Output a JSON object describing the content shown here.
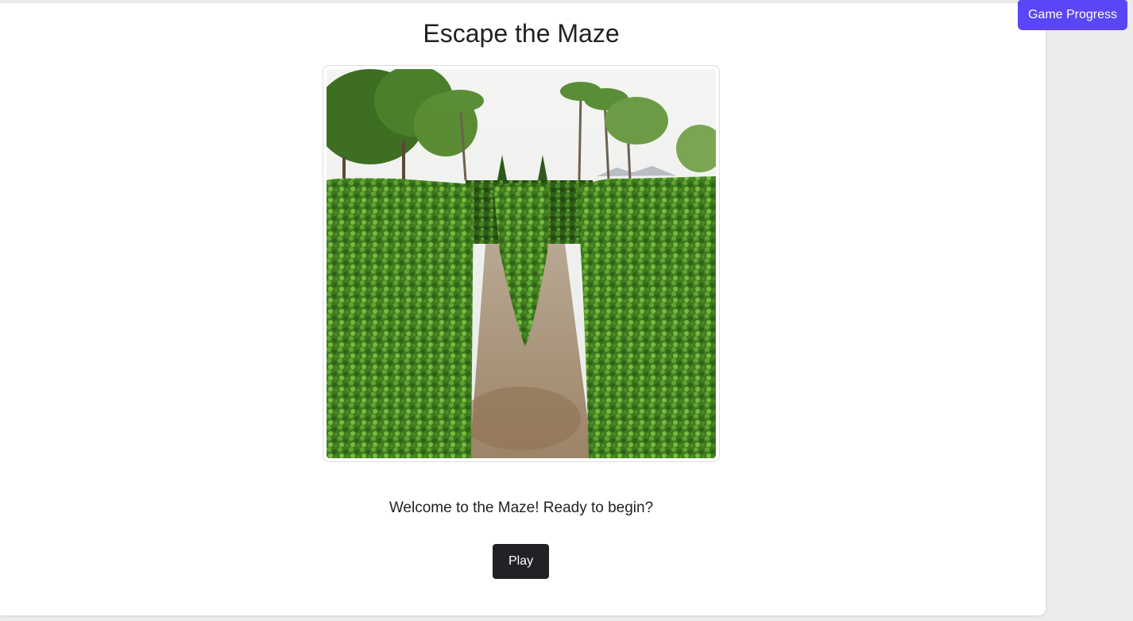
{
  "game": {
    "title": "Escape the Maze",
    "image_subject": "hedge maze path",
    "welcome_text": "Welcome to the Maze! Ready to begin?",
    "play_label": "Play"
  },
  "header": {
    "progress_label": "Game Progress"
  },
  "colors": {
    "accent": "#5b46f5",
    "play_button": "#212226",
    "background": "#ececec",
    "card": "#ffffff"
  }
}
